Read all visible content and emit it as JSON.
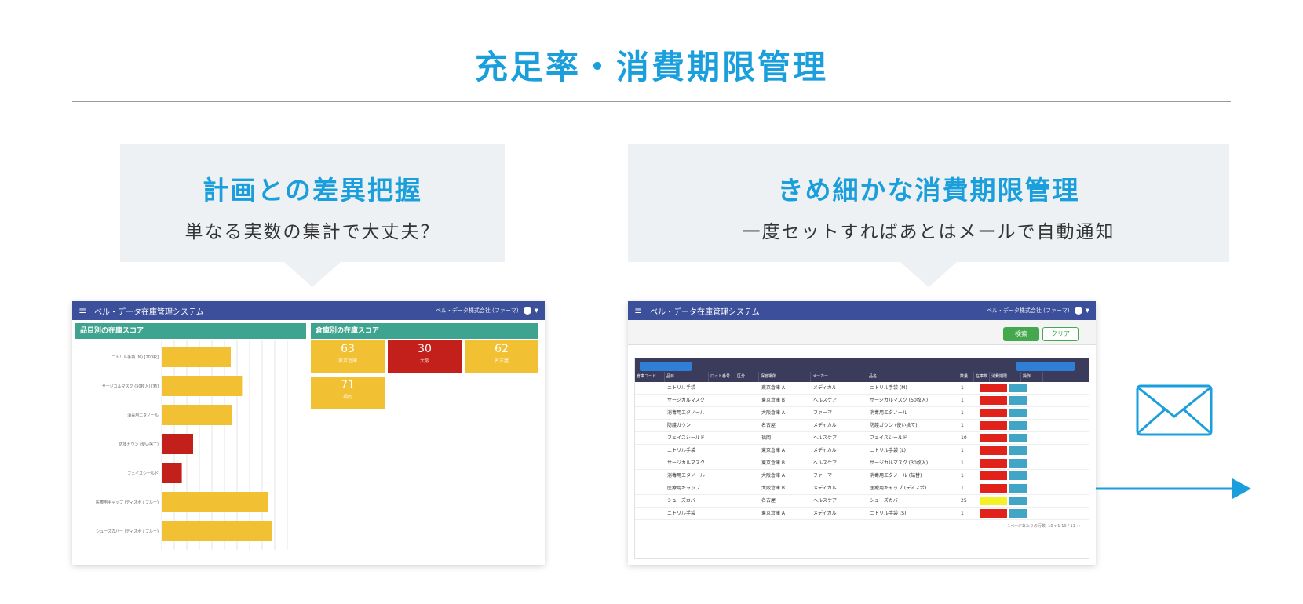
{
  "header": {
    "title": "充足率・消費期限管理"
  },
  "left": {
    "callout_title": "計画との差異把握",
    "callout_sub": "単なる実数の集計で大丈夫？",
    "app": {
      "title": "ベル・データ在庫管理システム",
      "user": "ベル・データ株式会社 (ファーマ)"
    },
    "panels": {
      "bars_title": "品目別の在庫スコア",
      "tiles_title": "倉庫別の在庫スコア"
    },
    "bars": [
      {
        "label": "ニトリル手袋 (M) [200枚]",
        "value": 55,
        "status": "yellow"
      },
      {
        "label": "サージカルマスク (50枚入) [箱]",
        "value": 64,
        "status": "yellow"
      },
      {
        "label": "消毒用エタノール",
        "value": 56,
        "status": "yellow"
      },
      {
        "label": "防護ガウン (使い捨て)",
        "value": 25,
        "status": "red"
      },
      {
        "label": "フェイスシールド",
        "value": 16,
        "status": "red"
      },
      {
        "label": "医療用キャップ (ディスポ / ブルー)",
        "value": 85,
        "status": "yellow"
      },
      {
        "label": "シューズカバー (ディスポ / ブルー)",
        "value": 88,
        "status": "yellow"
      }
    ],
    "bar_axis": {
      "min": 0,
      "max": 100
    },
    "tiles": [
      {
        "value": "63",
        "label": "東京倉庫",
        "status": "yellow"
      },
      {
        "value": "30",
        "label": "大阪",
        "status": "red"
      },
      {
        "value": "62",
        "label": "名古屋",
        "status": "yellow"
      },
      {
        "value": "71",
        "label": "福岡",
        "status": "yellow"
      }
    ],
    "colors": {
      "yellow": "#f2c033",
      "red": "#c4201b",
      "head": "#3fa48f"
    }
  },
  "right": {
    "callout_title": "きめ細かな消費期限管理",
    "callout_sub": "一度セットすればあとはメールで自動通知",
    "app": {
      "title": "ベル・データ在庫管理システム",
      "user": "ベル・データ株式会社 (ファーマ)"
    },
    "toolbar": {
      "search_label": "検索",
      "clear_label": "クリア"
    },
    "table": {
      "columns": [
        "倉庫コード",
        "品目",
        "ロット番号",
        "区分",
        "保管場所",
        "メーカー",
        "品名",
        "数量",
        "在庫数",
        "消費期限",
        "操作"
      ],
      "rows": [
        {
          "item": "ニトリル手袋",
          "loc": "東京倉庫 A",
          "maker": "メディカル",
          "name": "ニトリル手袋 (M)",
          "qty": "1",
          "date_status": "red"
        },
        {
          "item": "サージカルマスク",
          "loc": "東京倉庫 B",
          "maker": "ヘルスケア",
          "name": "サージカルマスク (50枚入)",
          "qty": "1",
          "date_status": "red"
        },
        {
          "item": "消毒用エタノール",
          "loc": "大阪倉庫 A",
          "maker": "ファーマ",
          "name": "消毒用エタノール",
          "qty": "1",
          "date_status": "red"
        },
        {
          "item": "防護ガウン",
          "loc": "名古屋",
          "maker": "メディカル",
          "name": "防護ガウン (使い捨て)",
          "qty": "1",
          "date_status": "red"
        },
        {
          "item": "フェイスシールド",
          "loc": "福岡",
          "maker": "ヘルスケア",
          "name": "フェイスシールド",
          "qty": "10",
          "date_status": "red"
        },
        {
          "item": "ニトリル手袋",
          "loc": "東京倉庫 A",
          "maker": "メディカル",
          "name": "ニトリル手袋 (L)",
          "qty": "1",
          "date_status": "red"
        },
        {
          "item": "サージカルマスク",
          "loc": "東京倉庫 B",
          "maker": "ヘルスケア",
          "name": "サージカルマスク (30枚入)",
          "qty": "1",
          "date_status": "red"
        },
        {
          "item": "消毒用エタノール",
          "loc": "大阪倉庫 A",
          "maker": "ファーマ",
          "name": "消毒用エタノール (詰替)",
          "qty": "1",
          "date_status": "red"
        },
        {
          "item": "医療用キャップ",
          "loc": "大阪倉庫 B",
          "maker": "メディカル",
          "name": "医療用キャップ (ディスポ)",
          "qty": "1",
          "date_status": "red"
        },
        {
          "item": "シューズカバー",
          "loc": "名古屋",
          "maker": "ヘルスケア",
          "name": "シューズカバー",
          "qty": "25",
          "date_status": "yellow"
        },
        {
          "item": "ニトリル手袋",
          "loc": "東京倉庫 A",
          "maker": "メディカル",
          "name": "ニトリル手袋 (S)",
          "qty": "1",
          "date_status": "red"
        }
      ],
      "pager": "1ページあたりの行数: 10 ▾   1-10 / 11   ‹  ›"
    },
    "colors": {
      "red": "#e0221b",
      "yellow": "#f4f224",
      "action": "#41a6c6"
    }
  }
}
